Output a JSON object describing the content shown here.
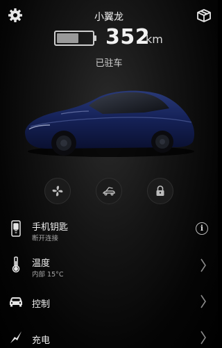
{
  "header": {
    "settings_icon": "gear-icon",
    "vehicle_name": "小翼龙",
    "box_icon": "package-icon"
  },
  "status": {
    "battery_level_fraction": 0.62,
    "range_value": "352",
    "range_unit": "km",
    "parking_status": "已驻车"
  },
  "quick_actions": [
    {
      "icon": "fan-icon"
    },
    {
      "icon": "trunk-icon"
    },
    {
      "icon": "lock-icon"
    }
  ],
  "menu": [
    {
      "icon": "phone-key-icon",
      "title": "手机钥匙",
      "subtitle": "断开连接",
      "trailing": "info-icon"
    },
    {
      "icon": "thermometer-icon",
      "title": "温度",
      "subtitle": "内部 15°C",
      "trailing": "chevron-right-icon"
    },
    {
      "icon": "car-icon",
      "title": "控制",
      "subtitle": "",
      "trailing": "chevron-right-icon"
    },
    {
      "icon": "charging-bolt-icon",
      "title": "充电",
      "subtitle": "",
      "trailing": "chevron-right-icon"
    }
  ],
  "colors": {
    "background": "#000000",
    "text": "#f2f2f2",
    "muted": "#a9a9a9",
    "car_body": "#14204a"
  }
}
